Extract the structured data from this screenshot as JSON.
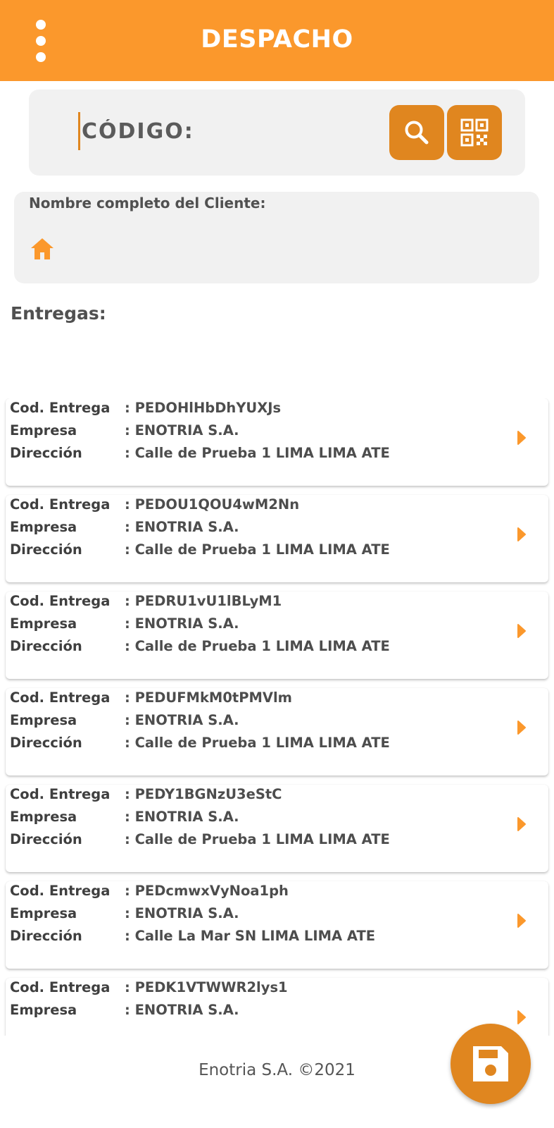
{
  "header": {
    "title": "DESPACHO",
    "menu_icon": "more-vertical-icon"
  },
  "search": {
    "placeholder": "CÓDIGO:",
    "value": "",
    "search_icon": "search-icon",
    "qr_icon": "qr-code-icon"
  },
  "client": {
    "label": "Nombre completo del Cliente:",
    "home_icon": "home-icon"
  },
  "section": {
    "title": "Entregas:"
  },
  "colors": {
    "primary": "#fb982c",
    "accent": "#e0861f",
    "panel": "#f1f1f1"
  },
  "deliveries": [
    {
      "code_label": "Cod. Entrega",
      "code": ": PEDOHlHbDhYUXJs",
      "company_label": "Empresa",
      "company": ": ENOTRIA S.A.",
      "address_label": "Dirección",
      "address": ": Calle de Prueba 1 LIMA LIMA ATE"
    },
    {
      "code_label": "Cod. Entrega",
      "code": ": PEDOU1QOU4wM2Nn",
      "company_label": "Empresa",
      "company": ": ENOTRIA S.A.",
      "address_label": "Dirección",
      "address": ": Calle de Prueba 1 LIMA LIMA ATE"
    },
    {
      "code_label": "Cod. Entrega",
      "code": ": PEDRU1vU1lBLyM1",
      "company_label": "Empresa",
      "company": ": ENOTRIA S.A.",
      "address_label": "Dirección",
      "address": ": Calle de Prueba 1 LIMA LIMA ATE"
    },
    {
      "code_label": "Cod. Entrega",
      "code": ": PEDUFMkM0tPMVlm",
      "company_label": "Empresa",
      "company": ": ENOTRIA S.A.",
      "address_label": "Dirección",
      "address": ": Calle de Prueba 1 LIMA LIMA ATE"
    },
    {
      "code_label": "Cod. Entrega",
      "code": ": PEDY1BGNzU3eStC",
      "company_label": "Empresa",
      "company": ": ENOTRIA S.A.",
      "address_label": "Dirección",
      "address": ": Calle de Prueba 1 LIMA LIMA ATE"
    },
    {
      "code_label": "Cod. Entrega",
      "code": ": PEDcmwxVyNoa1ph",
      "company_label": "Empresa",
      "company": ": ENOTRIA S.A.",
      "address_label": "Dirección",
      "address": ": Calle La Mar SN LIMA LIMA ATE"
    },
    {
      "code_label": "Cod. Entrega",
      "code": ": PEDK1VTWWR2lys1",
      "company_label": "Empresa",
      "company": ": ENOTRIA S.A.",
      "address_label": "",
      "address": ""
    }
  ],
  "footer": {
    "text": "Enotria S.A. ©2021"
  },
  "fab": {
    "icon": "save-icon"
  }
}
